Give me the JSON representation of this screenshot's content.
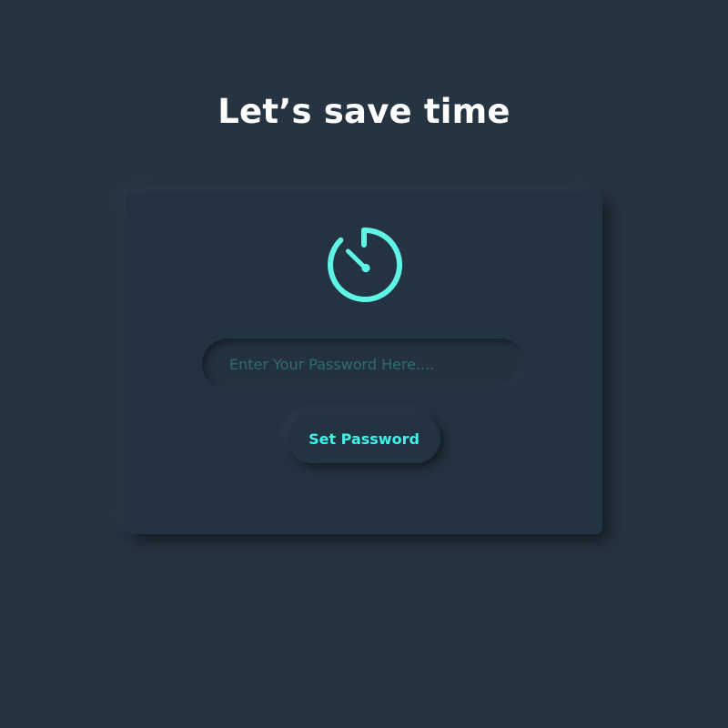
{
  "page": {
    "heading": "Let’s save time"
  },
  "card": {
    "icon": "stopwatch-icon",
    "password_input": {
      "value": "",
      "placeholder": "Enter Your Password Here...."
    },
    "submit_label": "Set Password"
  },
  "colors": {
    "background": "#263340",
    "card": "#243341",
    "accent": "#5ff5e6",
    "button_text": "#3ff2ea",
    "placeholder": "#2f6a70",
    "heading": "#ffffff"
  }
}
